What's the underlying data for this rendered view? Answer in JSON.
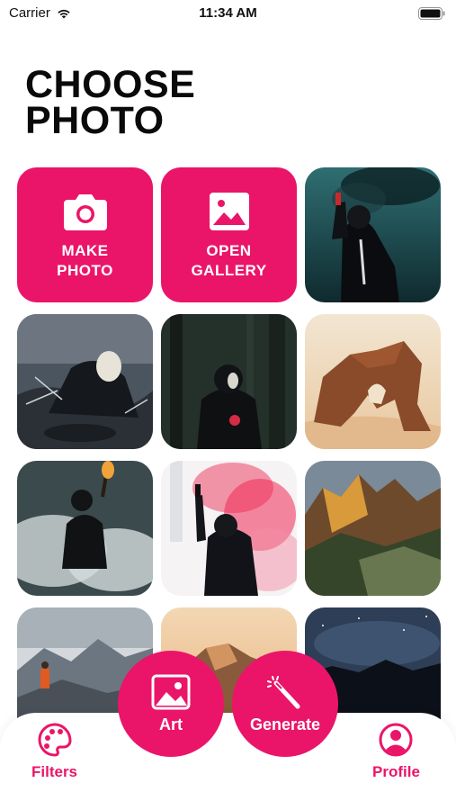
{
  "status_bar": {
    "carrier": "Carrier",
    "time": "11:34 AM"
  },
  "page": {
    "title": "CHOOSE PHOTO"
  },
  "actions": {
    "make_photo": {
      "label": "MAKE\nPHOTO",
      "icon": "camera-icon"
    },
    "open_gallery": {
      "label": "OPEN\nGALLERY",
      "icon": "image-icon"
    }
  },
  "tab_bar": {
    "filters": {
      "label": "Filters",
      "icon": "palette-icon"
    },
    "art": {
      "label": "Art",
      "icon": "image-icon"
    },
    "generate": {
      "label": "Generate",
      "icon": "magic-wand-icon"
    },
    "profile": {
      "label": "Profile",
      "icon": "user-icon"
    }
  },
  "colors": {
    "accent": "#ea1569",
    "title": "#0a0a0a",
    "background": "#ffffff"
  }
}
